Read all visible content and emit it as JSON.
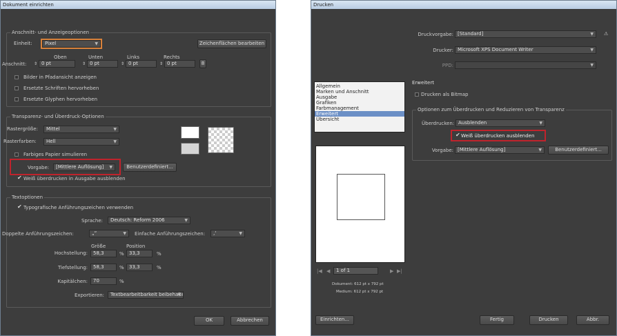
{
  "left": {
    "title": "Dokument einrichten",
    "g1": {
      "head": "Anschnitt- und Anzeigeoptionen",
      "unit_label": "Einheit:",
      "unit_value": "Pixel",
      "artboards_button": "Zeichenflächen bearbeiten",
      "col_oben": "Oben",
      "col_unten": "Unten",
      "col_links": "Links",
      "col_rechts": "Rechts",
      "bleed_label": "Anschnitt:",
      "bleed_oben": "0 pt",
      "bleed_unten": "0 pt",
      "bleed_links": "0 pt",
      "bleed_rechts": "0 pt",
      "opt1": "Bilder in Pfadansicht anzeigen",
      "opt2": "Ersetzte Schriften hervorheben",
      "opt3": "Ersetzte Glyphen hervorheben"
    },
    "g2": {
      "head": "Transparenz- und Überdruck-Optionen",
      "grid_label": "Rastergröße:",
      "grid_value": "Mittel",
      "colors_label": "Rasterfarben:",
      "colors_value": "Hell",
      "paper": "Farbiges Papier simulieren",
      "preset_label": "Vorgabe:",
      "preset_value": "[Mittlere Auflösung]",
      "custom_button": "Benutzerdefiniert...",
      "white": "Weiß überdrucken in Ausgabe ausblenden"
    },
    "g3": {
      "head": "Textoptionen",
      "typo": "Typografische Anführungszeichen verwenden",
      "lang_label": "Sprache:",
      "lang_value": "Deutsch: Reform 2006",
      "dq_label": "Doppelte Anführungszeichen:",
      "dq_value": "„“",
      "sq_label": "Einfache Anführungszeichen:",
      "sq_value": "‚‘",
      "size": "Größe",
      "position": "Position",
      "sup_label": "Hochstellung:",
      "sup_size": "58,3",
      "sup_pos": "33,3",
      "sub_label": "Tiefstellung:",
      "sub_size": "58,3",
      "sub_pos": "33,3",
      "caps_label": "Kapitälchen:",
      "caps_value": "70",
      "pct": "%",
      "export_label": "Exportieren:",
      "export_value": "Textbearbeitbarkeit beibehalten"
    },
    "ok": "OK",
    "cancel": "Abbrechen"
  },
  "right": {
    "title": "Drucken",
    "preset_label": "Druckvorgabe:",
    "preset_value": "[Standard]",
    "printer_label": "Drucker:",
    "printer_value": "Microsoft XPS Document Writer",
    "ppd_label": "PPD:",
    "nav": [
      "Allgemein",
      "Marken und Anschnitt",
      "Ausgabe",
      "Grafiken",
      "Farbmanagement",
      "Erweitert",
      "Übersicht"
    ],
    "section": "Erweitert",
    "bitmap": "Drucken als Bitmap",
    "overprint_head": "Optionen zum Überdrucken und Reduzieren von Transparenz",
    "overprint_label": "Überdrucken:",
    "overprint_value": "Ausblenden",
    "white": "Weiß überdrucken ausblenden",
    "preset2_label": "Vorgabe:",
    "preset2_value": "[Mittlere Auflösung]",
    "custom_button": "Benutzerdefiniert...",
    "page": "1 of 1",
    "doc_info": "Dokument: 612 pt x 792 pt",
    "media_info": "Medium: 612 pt x 792 pt",
    "setup": "Einrichten...",
    "done": "Fertig",
    "print": "Drucken",
    "cancel": "Abbr."
  }
}
